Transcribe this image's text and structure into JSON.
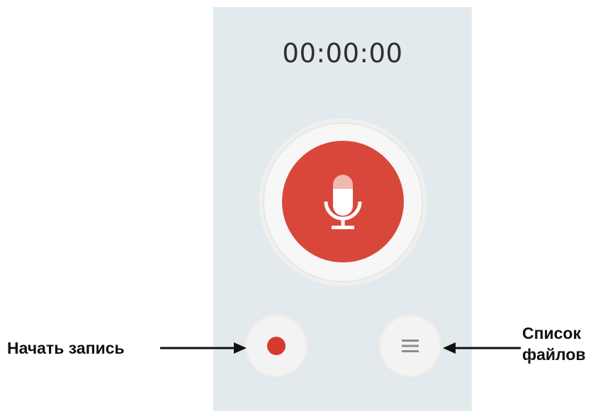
{
  "recorder": {
    "timer": "00:00:00",
    "mic_button_color": "#d9473b",
    "record_dot_color": "#d8392f",
    "background": "#e3eaee"
  },
  "callouts": {
    "start_recording": "Начать запись",
    "file_list_line1": "Список",
    "file_list_line2": "файлов"
  },
  "icons": {
    "mic": "microphone-icon",
    "record": "record-dot-icon",
    "list": "menu-list-icon"
  }
}
